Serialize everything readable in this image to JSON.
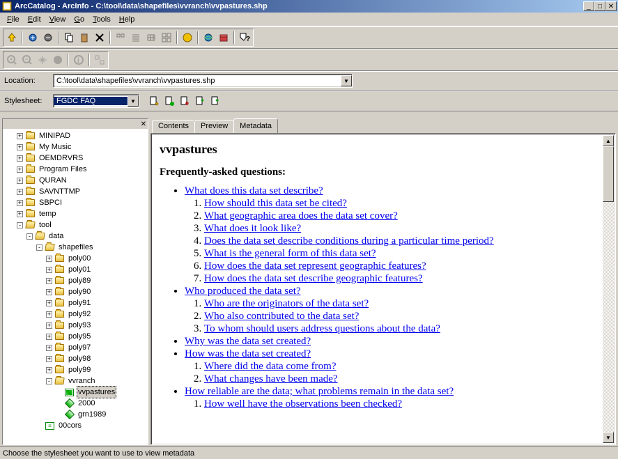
{
  "title": "ArcCatalog - ArcInfo - C:\\tool\\data\\shapefiles\\vvranch\\vvpastures.shp",
  "menu": [
    "File",
    "Edit",
    "View",
    "Go",
    "Tools",
    "Help"
  ],
  "location": {
    "label": "Location:",
    "value": "C:\\tool\\data\\shapefiles\\vvranch\\vvpastures.shp"
  },
  "stylesheet": {
    "label": "Stylesheet:",
    "value": "FGDC FAQ"
  },
  "tree": [
    {
      "i": 1,
      "exp": "+",
      "icon": "folder",
      "label": "MINIPAD"
    },
    {
      "i": 1,
      "exp": "+",
      "icon": "folder",
      "label": "My Music"
    },
    {
      "i": 1,
      "exp": "+",
      "icon": "folder",
      "label": "OEMDRVRS"
    },
    {
      "i": 1,
      "exp": "+",
      "icon": "folder",
      "label": "Program Files"
    },
    {
      "i": 1,
      "exp": "+",
      "icon": "folder",
      "label": "QURAN"
    },
    {
      "i": 1,
      "exp": "+",
      "icon": "folder",
      "label": "SAVNTTMP"
    },
    {
      "i": 1,
      "exp": "+",
      "icon": "folder",
      "label": "SBPCI"
    },
    {
      "i": 1,
      "exp": "+",
      "icon": "folder",
      "label": "temp"
    },
    {
      "i": 1,
      "exp": "-",
      "icon": "folder-open",
      "label": "tool"
    },
    {
      "i": 2,
      "exp": "-",
      "icon": "folder-open",
      "label": "data"
    },
    {
      "i": 3,
      "exp": "-",
      "icon": "folder-open",
      "label": "shapefiles"
    },
    {
      "i": 4,
      "exp": "+",
      "icon": "folder",
      "label": "poly00"
    },
    {
      "i": 4,
      "exp": "+",
      "icon": "folder",
      "label": "poly01"
    },
    {
      "i": 4,
      "exp": "+",
      "icon": "folder",
      "label": "poly89"
    },
    {
      "i": 4,
      "exp": "+",
      "icon": "folder",
      "label": "poly90"
    },
    {
      "i": 4,
      "exp": "+",
      "icon": "folder",
      "label": "poly91"
    },
    {
      "i": 4,
      "exp": "+",
      "icon": "folder",
      "label": "poly92"
    },
    {
      "i": 4,
      "exp": "+",
      "icon": "folder",
      "label": "poly93"
    },
    {
      "i": 4,
      "exp": "+",
      "icon": "folder",
      "label": "poly95"
    },
    {
      "i": 4,
      "exp": "+",
      "icon": "folder",
      "label": "poly97"
    },
    {
      "i": 4,
      "exp": "+",
      "icon": "folder",
      "label": "poly98"
    },
    {
      "i": 4,
      "exp": "+",
      "icon": "folder",
      "label": "poly99"
    },
    {
      "i": 4,
      "exp": "-",
      "icon": "folder-open",
      "label": "vvranch"
    },
    {
      "i": 5,
      "exp": "",
      "icon": "shp",
      "label": "vvpastures",
      "sel": true
    },
    {
      "i": 5,
      "exp": "",
      "icon": "diamond",
      "label": "2000"
    },
    {
      "i": 5,
      "exp": "",
      "icon": "diamond",
      "label": "grn1989"
    },
    {
      "i": 3,
      "exp": "",
      "icon": "tbl",
      "label": "00cors"
    }
  ],
  "tabs": [
    "Contents",
    "Preview",
    "Metadata"
  ],
  "activeTab": 2,
  "metadata": {
    "title": "vvpastures",
    "faqTitle": "Frequently-asked questions:",
    "q1": "What does this data set describe?",
    "q1s": [
      "How should this data set be cited?",
      "What geographic area does the data set cover?",
      "What does it look like?",
      "Does the data set describe conditions during a particular time period?",
      "What is the general form of this data set?",
      "How does the data set represent geographic features?",
      "How does the data set describe geographic features?"
    ],
    "q2": "Who produced the data set?",
    "q2s": [
      "Who are the originators of the data set?",
      "Who also contributed to the data set?",
      "To whom should users address questions about the data?"
    ],
    "q3": "Why was the data set created?",
    "q4": "How was the data set created?",
    "q4s": [
      "Where did the data come from?",
      "What changes have been made?"
    ],
    "q5": "How reliable are the data; what problems remain in the data set?",
    "q5s1": "How well have the observations been checked?"
  },
  "status": "Choose the stylesheet you want to use to view metadata"
}
